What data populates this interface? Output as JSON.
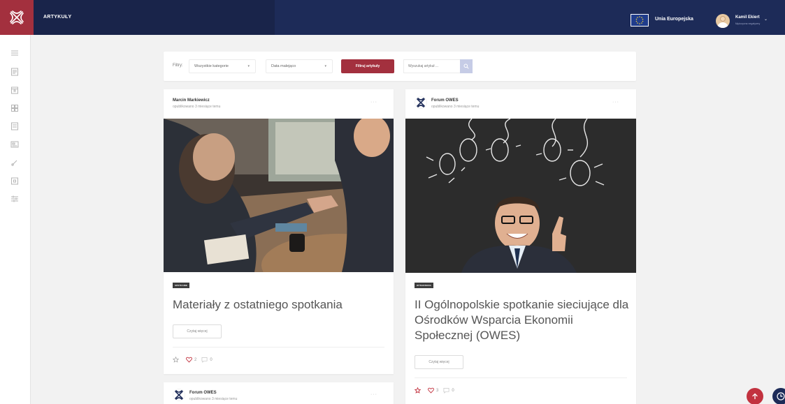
{
  "header": {
    "title": "ARTYKUŁY",
    "eu_label": "Unia Europejska",
    "user_name": "Kamil Ekiert",
    "user_subtitle": "Mężczyzna negatywny"
  },
  "sidebar": {
    "icons": [
      "menu-icon",
      "articles-icon",
      "calendar-icon",
      "grid-icon",
      "notes-icon",
      "media-icon",
      "link-icon",
      "document-icon",
      "settings-icon"
    ]
  },
  "filters": {
    "label": "Filtry:",
    "category_value": "Wszystkie kategorie",
    "sort_value": "Data malejąco",
    "filter_button": "Filtruj artykuły",
    "search_placeholder": "Wyszukaj artykuł ..."
  },
  "cards": [
    {
      "author": "Marcin Markiewicz",
      "date": "opublikowano 3 miesiące temu",
      "tag": "SPOTKANIE",
      "title": "Materiały z ostatniego spotkania",
      "read_more": "Czytaj więcej",
      "likes": "2",
      "comments": "0"
    },
    {
      "author": "Forum OWES",
      "date": "opublikowano 3 miesiące temu",
      "tag": "WYDARZENIA",
      "title": "II Ogólnopolskie spotkanie sieciujące dla Ośrodków Wsparcia Ekonomii Społecznej (OWES)",
      "read_more": "Czytaj więcej",
      "likes": "3",
      "comments": "0"
    },
    {
      "author": "Forum OWES",
      "date": "opublikowano 3 miesiące temu"
    }
  ],
  "more_label": "···",
  "colors": {
    "brand_red": "#a3303e",
    "nav_blue": "#1d2b58",
    "background": "#f2f2f2"
  }
}
